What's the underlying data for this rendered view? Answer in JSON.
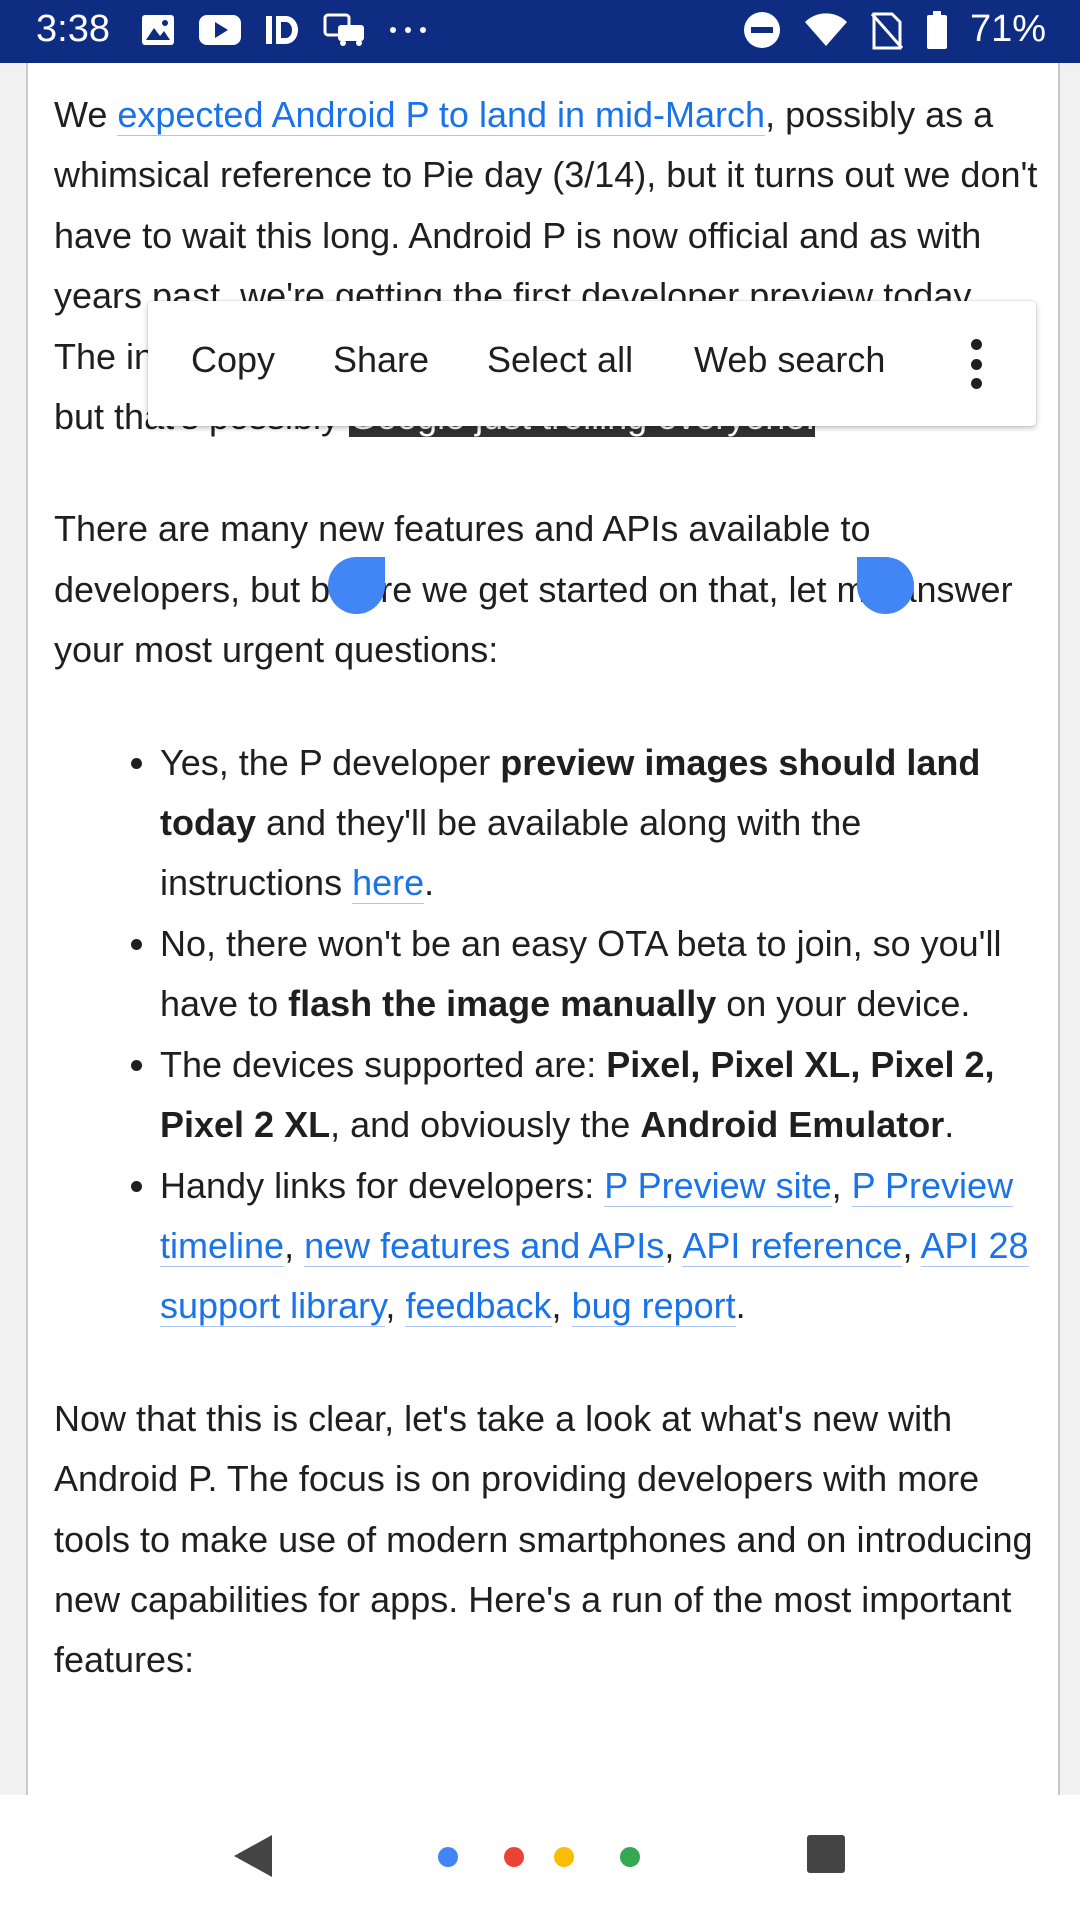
{
  "status_bar": {
    "time": "3:38",
    "battery": "71%",
    "bg_color": "#0d2c82",
    "left_icons": [
      "image-icon",
      "youtube-icon",
      "id-icon",
      "car-icon",
      "more-dots-icon"
    ],
    "right_icons": [
      "do-not-disturb-icon",
      "wifi-icon",
      "no-sim-icon",
      "battery-icon"
    ]
  },
  "article": {
    "p1": {
      "lead": "We ",
      "link": "expected Android P to land in mid-March",
      "after_link": ", possibly as a whimsical reference to Pie day (3/14), but it turns out we don't have to wait this long. Android P is now official and as with years past, we're getting the first developer preview today",
      "line_the_start": "The in",
      "pre_selection": "but that's possibly ",
      "selected": "Google just trolling everyone."
    },
    "p2": "There are many new features and APIs available to developers, but before we get started on that, let me answer your most urgent questions:",
    "bullets": {
      "b1": {
        "t1": "Yes, the P developer ",
        "bold": "preview images should land today",
        "t2": " and they'll be available along with the instructions ",
        "link": "here",
        "t3": "."
      },
      "b2": {
        "t1": "No, there won't be an easy OTA beta to join, so you'll have to ",
        "bold": "flash the image manually",
        "t2": " on your device."
      },
      "b3": {
        "t1": "The devices supported are: ",
        "bold1": "Pixel, Pixel XL, Pixel 2, Pixel 2 XL",
        "t2": ", and obviously the ",
        "bold2": "Android Emulator",
        "t3": "."
      },
      "b4": {
        "t1": "Handy links for developers: ",
        "links": [
          "P Preview site",
          "P Preview timeline",
          "new features and APIs",
          "API reference",
          "API 28 support library",
          "feedback",
          "bug report"
        ],
        "sep": ", ",
        "end": "."
      }
    },
    "p3": "Now that this is clear, let's take a look at what's new with Android P. The focus is on providing developers with more tools to make use of modern smartphones and on introducing new capabilities for apps. Here's a run of the most important features:"
  },
  "context_menu": {
    "copy": "Copy",
    "share": "Share",
    "select_all": "Select all",
    "web_search": "Web search",
    "more_icon": "more-vert-icon"
  },
  "nav_bar": {
    "back_icon": "back-triangle-icon",
    "home_icon": "google-assistant-dots-icon",
    "recents_icon": "recents-square-icon",
    "dot_colors": [
      "#4285f4",
      "#ea4335",
      "#fbbc04",
      "#34a853"
    ]
  },
  "colors": {
    "link": "#1a73e8",
    "selection": "#313131",
    "handle": "#4285f4"
  }
}
